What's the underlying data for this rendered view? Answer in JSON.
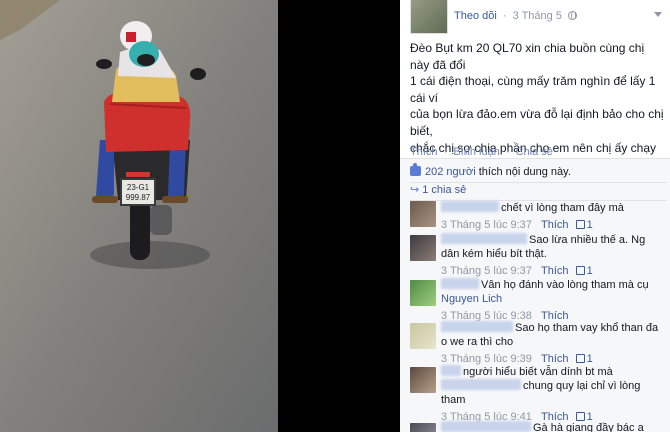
{
  "photo": {
    "plate_line1": "23-G1",
    "plate_line2": "999.87"
  },
  "post": {
    "follow_label": "Theo dõi",
    "separator": "·",
    "date": "3 Tháng 5",
    "text": "Đèo Bụt km 20 QL70 xin chia buồn cùng chị này đã đổi\n1 cái điện thoại, cùng mấy trăm nghìn để lấy 1 cái ví\ncủa bọn lừa đảo.em vừa đỗ lại định bảo cho chị biết,\nchắc chị sợ chia phần cho em nên chị ấy chạy luôn em\nđuổi mãi không được ai biết chị ấy ở đâu chia buồn hộ\nem với nhé.",
    "actions": {
      "like": "Thích",
      "comment": "Bình luận",
      "share": "Chia sẻ",
      "dot": "·"
    },
    "likes_count": "202 người",
    "likes_suffix": "thích nội dung này.",
    "shares": "1 chia sẻ"
  },
  "comments": [
    {
      "text": "chết vì lòng tham đây mà",
      "time": "3 Tháng 5 lúc 9:37",
      "like_label": "Thích",
      "likes": "1"
    },
    {
      "text_line1": "Sao lừa nhiều thế a. Ng",
      "text_line2": "dân kém hiểu bít thật.",
      "time": "3 Tháng 5 lúc 9:37",
      "like_label": "Thích",
      "likes": "1"
    },
    {
      "text_line1": "Vân họ đánh vào lòng tham mà cụ",
      "mention": "Nguyen Lich",
      "time": "3 Tháng 5 lúc 9:38",
      "like_label": "Thích"
    },
    {
      "text_line1": "Sao họ tham vay khổ than đa",
      "text_line2": "o we ra thì cho",
      "time": "3 Tháng 5 lúc 9:39",
      "like_label": "Thích",
      "likes": "1"
    },
    {
      "text_line1": "người hiểu biết vẫn dính bt mà",
      "text_line2": "chung quy lại chỉ vì lòng",
      "text_line3": "tham",
      "time": "3 Tháng 5 lúc 9:41",
      "like_label": "Thích",
      "likes": "1"
    },
    {
      "text_line1": "Gà hà giang đầy bác a"
    }
  ]
}
